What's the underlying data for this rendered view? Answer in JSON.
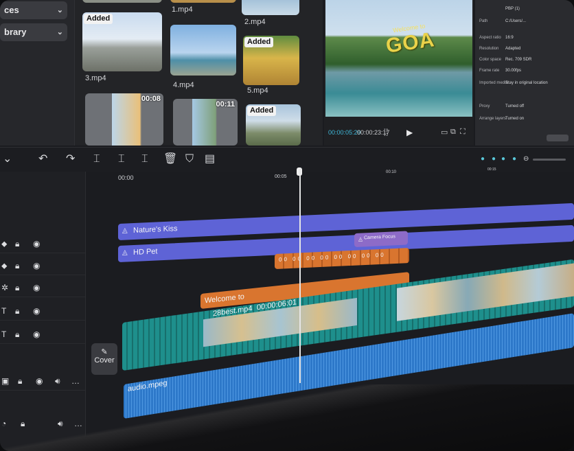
{
  "sidebar": {
    "items": [
      {
        "label": "ces",
        "icon": "chevron-down-icon"
      },
      {
        "label": "brary",
        "icon": "chevron-down-icon"
      }
    ]
  },
  "media": {
    "clips": [
      {
        "label": "1.mp4",
        "badge": "",
        "duration": ""
      },
      {
        "label": "2.mp4",
        "badge": "",
        "duration": ""
      },
      {
        "label": "3.mp4",
        "badge": "Added",
        "duration": ""
      },
      {
        "label": "4.mp4",
        "badge": "",
        "duration": ""
      },
      {
        "label": "5.mp4",
        "badge": "Added",
        "duration": ""
      },
      {
        "label": "",
        "badge": "",
        "duration": "00:08"
      },
      {
        "label": "",
        "badge": "",
        "duration": "00:11"
      },
      {
        "label": "",
        "badge": "Added",
        "duration": ""
      }
    ]
  },
  "preview": {
    "overlay_text": "GOA",
    "overlay_small": "Welcome to",
    "current_time": "00:00:05:29",
    "total_time": "00:00:23:17"
  },
  "properties": {
    "rows": [
      {
        "key": "",
        "value": "PBP (1)"
      },
      {
        "key": "Path",
        "value": "C:/Users/..."
      },
      {
        "key": "Aspect ratio",
        "value": "16:9"
      },
      {
        "key": "Resolution",
        "value": "Adapted"
      },
      {
        "key": "Color space",
        "value": "Rec. 709 SDR"
      },
      {
        "key": "Frame rate",
        "value": "30.00fps"
      },
      {
        "key": "Imported media",
        "value": "Stay in original location"
      },
      {
        "key": "Proxy",
        "value": "Turned off"
      },
      {
        "key": "Arrange layers",
        "value": "Turned on"
      }
    ]
  },
  "timeline": {
    "ruler": [
      "00:00",
      "00:05",
      "00:10",
      "00:15"
    ],
    "tracks": {
      "natures_kiss": "Nature's Kiss",
      "hd_pet": "HD Pet",
      "camera_focus": "Camera Focus",
      "welcome": "Welcome to",
      "main_clip": "28best.mp4",
      "main_clip_time": "00:00:06:01",
      "audio": "audio.mpeg",
      "speed_clip": "00 00 00 00 00 00 00 00"
    },
    "cover_label": "Cover"
  },
  "colors": {
    "purple_bar": "#5e63d6",
    "orange_clip": "#d9752f",
    "teal_clip": "#1e8f8c",
    "audio_blue": "#2d78c9",
    "effect_purple": "#8d6bc8"
  }
}
